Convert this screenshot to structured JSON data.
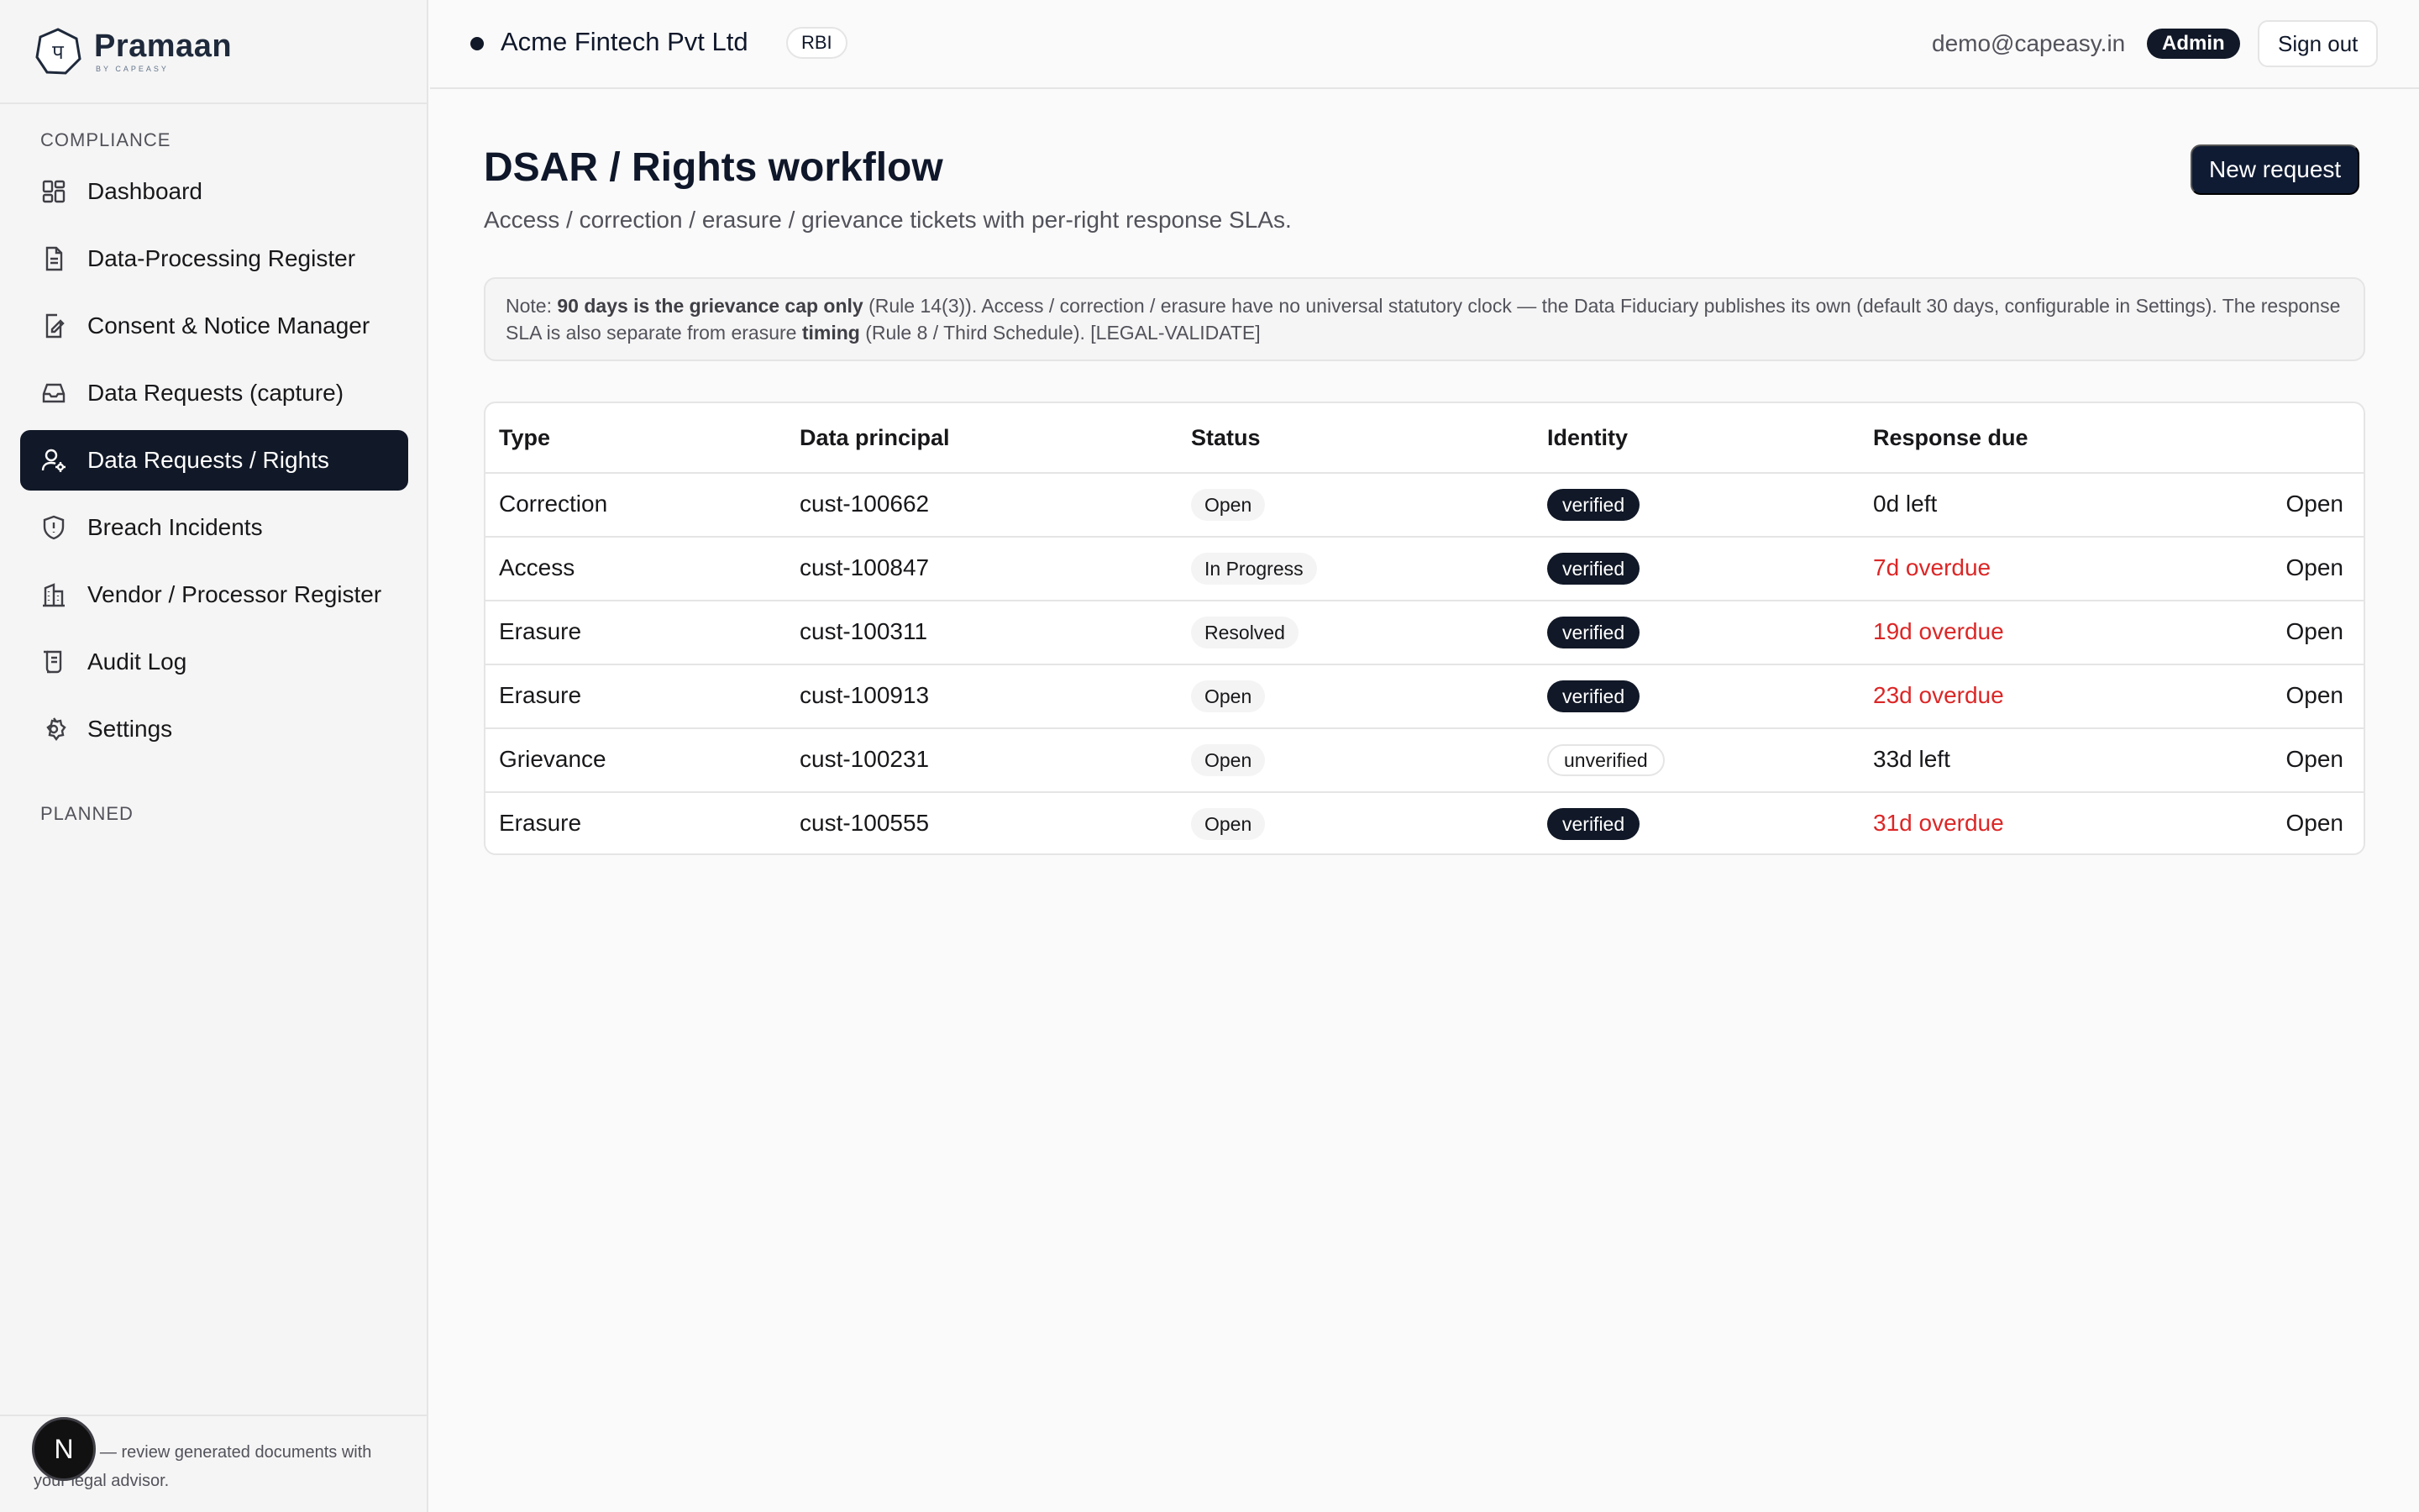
{
  "brand": {
    "name": "Pramaan",
    "sub": "BY CAPEASY",
    "logo_glyph": "प"
  },
  "sidebar": {
    "sections": [
      {
        "label": "COMPLIANCE"
      },
      {
        "label": "PLANNED"
      }
    ],
    "items": [
      {
        "label": "Dashboard",
        "icon": "grid-icon"
      },
      {
        "label": "Data-Processing Register",
        "icon": "document-icon"
      },
      {
        "label": "Consent & Notice Manager",
        "icon": "edit-document-icon"
      },
      {
        "label": "Data Requests (capture)",
        "icon": "inbox-icon"
      },
      {
        "label": "Data Requests / Rights",
        "icon": "user-gear-icon",
        "active": true
      },
      {
        "label": "Breach Incidents",
        "icon": "shield-alert-icon"
      },
      {
        "label": "Vendor / Processor Register",
        "icon": "building-icon"
      },
      {
        "label": "Audit Log",
        "icon": "scroll-icon"
      },
      {
        "label": "Settings",
        "icon": "gear-icon"
      }
    ],
    "footer_note": "…ooling — review generated documents with your legal advisor.",
    "avatar_letter": "N"
  },
  "topbar": {
    "org_name": "Acme Fintech Pvt Ltd",
    "org_badge": "RBI",
    "user_email": "demo@capeasy.in",
    "role": "Admin",
    "signout_label": "Sign out"
  },
  "page": {
    "title": "DSAR / Rights workflow",
    "subtitle": "Access / correction / erasure / grievance tickets with per-right response SLAs.",
    "new_request_label": "New request",
    "note": {
      "prefix": "Note: ",
      "bold1": "90 days is the grievance cap only",
      "mid1": " (Rule 14(3)). Access / correction / erasure have no universal statutory clock — the Data Fiduciary publishes its own (default 30 days, configurable in Settings). The response SLA is also separate from erasure ",
      "bold2": "timing",
      "mid2": " (Rule 8 / Third Schedule). ",
      "tag": "[LEGAL-VALIDATE]"
    }
  },
  "table": {
    "columns": [
      "Type",
      "Data principal",
      "Status",
      "Identity",
      "Response due"
    ],
    "rows": [
      {
        "type": "Correction",
        "principal": "cust-100662",
        "status": "Open",
        "identity": "verified",
        "due": "0d left",
        "overdue": false,
        "action": "Open"
      },
      {
        "type": "Access",
        "principal": "cust-100847",
        "status": "In Progress",
        "identity": "verified",
        "due": "7d overdue",
        "overdue": true,
        "action": "Open"
      },
      {
        "type": "Erasure",
        "principal": "cust-100311",
        "status": "Resolved",
        "identity": "verified",
        "due": "19d overdue",
        "overdue": true,
        "action": "Open"
      },
      {
        "type": "Erasure",
        "principal": "cust-100913",
        "status": "Open",
        "identity": "verified",
        "due": "23d overdue",
        "overdue": true,
        "action": "Open"
      },
      {
        "type": "Grievance",
        "principal": "cust-100231",
        "status": "Open",
        "identity": "unverified",
        "due": "33d left",
        "overdue": false,
        "action": "Open"
      },
      {
        "type": "Erasure",
        "principal": "cust-100555",
        "status": "Open",
        "identity": "verified",
        "due": "31d overdue",
        "overdue": true,
        "action": "Open"
      }
    ]
  },
  "colors": {
    "primary": "#111827",
    "overdue": "#dc2626",
    "muted": "#52525b"
  }
}
